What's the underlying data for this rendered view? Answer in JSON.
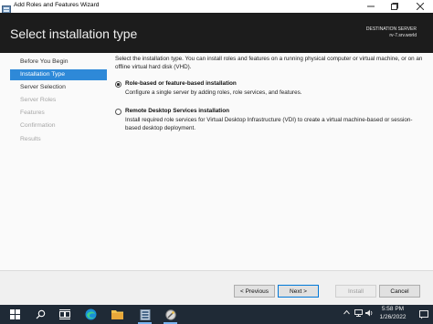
{
  "window": {
    "title": "Add Roles and Features Wizard",
    "controls": {
      "minimize": "minimize-icon",
      "maximize": "maximize-icon",
      "close": "close-icon"
    }
  },
  "header": {
    "page_title": "Select installation type",
    "destination_label": "DESTINATION SERVER",
    "destination_server": "rv-7.srv.world"
  },
  "nav": {
    "items": [
      {
        "label": "Before You Begin",
        "state": "normal"
      },
      {
        "label": "Installation Type",
        "state": "active"
      },
      {
        "label": "Server Selection",
        "state": "normal"
      },
      {
        "label": "Server Roles",
        "state": "disabled"
      },
      {
        "label": "Features",
        "state": "disabled"
      },
      {
        "label": "Confirmation",
        "state": "disabled"
      },
      {
        "label": "Results",
        "state": "disabled"
      }
    ]
  },
  "main": {
    "intro": "Select the installation type. You can install roles and features on a running physical computer or virtual machine, or on an offline virtual hard disk (VHD).",
    "options": [
      {
        "title": "Role-based or feature-based installation",
        "description": "Configure a single server by adding roles, role services, and features.",
        "selected": true
      },
      {
        "title": "Remote Desktop Services installation",
        "description": "Install required role services for Virtual Desktop Infrastructure (VDI) to create a virtual machine-based or session-based desktop deployment.",
        "selected": false
      }
    ]
  },
  "footer": {
    "previous": "< Previous",
    "next": "Next >",
    "install": "Install",
    "cancel": "Cancel"
  },
  "taskbar": {
    "icons": [
      "windows-start-icon",
      "search-icon",
      "task-view-icon",
      "edge-browser-icon",
      "file-explorer-icon",
      "server-manager-icon",
      "wizard-app-icon"
    ],
    "tray_icons": [
      "chevron-up-icon",
      "network-icon",
      "speaker-icon"
    ],
    "time": "5:58 PM",
    "date": "1/26/2022"
  },
  "colors": {
    "header_bg": "#1c1c1c",
    "accent_blue": "#2e89d8",
    "taskbar_bg": "#1f2a36"
  }
}
